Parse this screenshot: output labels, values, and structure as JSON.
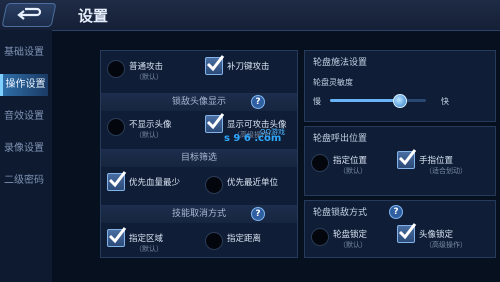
{
  "header": {
    "title": "设置"
  },
  "sidebar": {
    "items": [
      {
        "label": "基础设置",
        "active": false
      },
      {
        "label": "操作设置",
        "active": true
      },
      {
        "label": "音效设置",
        "active": false
      },
      {
        "label": "录像设置",
        "active": false
      },
      {
        "label": "二级密码",
        "active": false
      }
    ]
  },
  "attack": {
    "opt1": {
      "label": "普通攻击",
      "sub": "（默认）",
      "selected": false
    },
    "opt2": {
      "label": "补刀键攻击",
      "sub": "",
      "selected": true
    }
  },
  "lock_display": {
    "title": "锁敌头像显示",
    "opt1": {
      "label": "不显示头像",
      "sub": "（默认）",
      "selected": false
    },
    "opt2": {
      "label": "显示可攻击头像",
      "sub": "（高级操作）",
      "selected": true
    }
  },
  "target_filter": {
    "title": "目标筛选",
    "opt1": {
      "label": "优先血量最少",
      "selected": true
    },
    "opt2": {
      "label": "优先最近单位",
      "selected": false
    }
  },
  "skill_cancel": {
    "title": "技能取消方式",
    "opt1": {
      "label": "指定区域",
      "sub": "（默认）",
      "selected": true
    },
    "opt2": {
      "label": "指定距离",
      "selected": false
    }
  },
  "wheel_cast": {
    "title": "轮盘施法设置",
    "sensitivity_label": "轮盘灵敏度",
    "slow_label": "慢",
    "fast_label": "快",
    "sensitivity_value": 0.72
  },
  "wheel_position": {
    "title": "轮盘呼出位置",
    "opt1": {
      "label": "指定位置",
      "sub": "（默认）",
      "selected": false
    },
    "opt2": {
      "label": "手指位置",
      "sub": "（适合划动）",
      "selected": true
    }
  },
  "wheel_lock": {
    "title": "轮盘锁敌方式",
    "opt1": {
      "label": "轮盘锁定",
      "sub": "（默认）",
      "selected": false
    },
    "opt2": {
      "label": "头像锁定",
      "sub": "（高级操作）",
      "selected": true
    }
  },
  "watermark": {
    "text": "s 9 6 .com",
    "subtext": "QQ游戏"
  },
  "colors": {
    "accent": "#67b3f5",
    "background": "#07101f",
    "panel": "#0f1e36"
  }
}
